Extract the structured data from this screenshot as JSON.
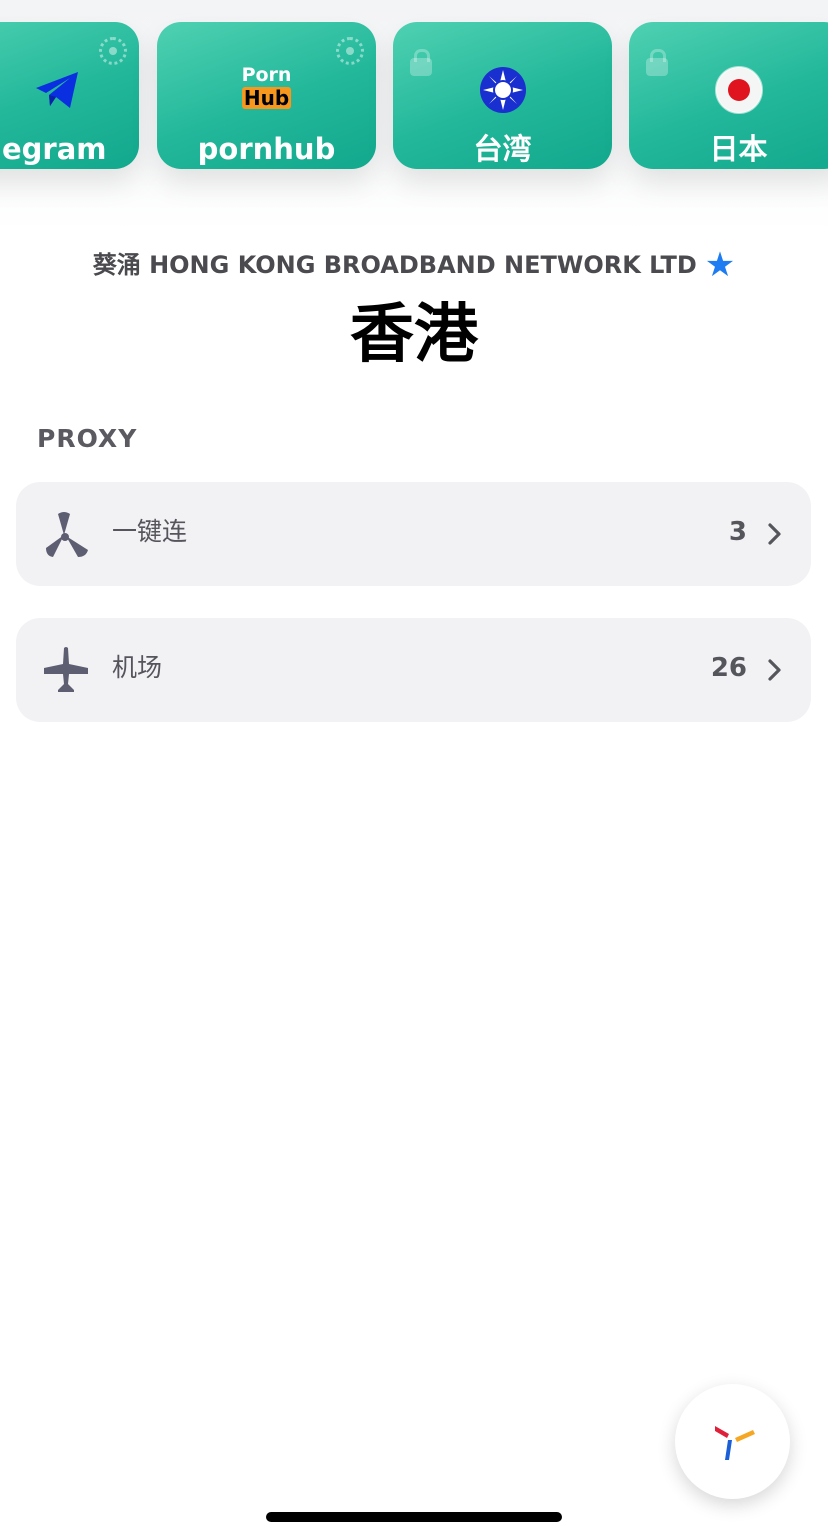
{
  "carousel": {
    "cards": [
      {
        "label": "egram",
        "icon": "telegram-icon"
      },
      {
        "label": "pornhub",
        "icon": "pornhub-logo",
        "logo_top": "Porn",
        "logo_bottom": "Hub"
      },
      {
        "label": "台湾",
        "icon": "taiwan-sun-icon",
        "locked": true
      },
      {
        "label": "日本",
        "icon": "japan-flag-icon",
        "locked": true
      }
    ]
  },
  "node": {
    "location": "葵涌 HONG KONG BROADBAND NETWORK LTD",
    "favorite_icon": "star-icon",
    "favorite_color": "#1d7cf2",
    "region": "香港"
  },
  "proxy": {
    "section_title": "PROXY",
    "groups": [
      {
        "label": "一键连",
        "count": "3",
        "icon": "propeller-icon"
      },
      {
        "label": "机场",
        "count": "26",
        "icon": "airplane-icon"
      }
    ]
  },
  "fab": {
    "icon": "app-logo-icon"
  },
  "colors": {
    "card_gradient_start": "#4fd1b2",
    "card_gradient_end": "#12a88d",
    "row_background": "#f2f2f5"
  }
}
